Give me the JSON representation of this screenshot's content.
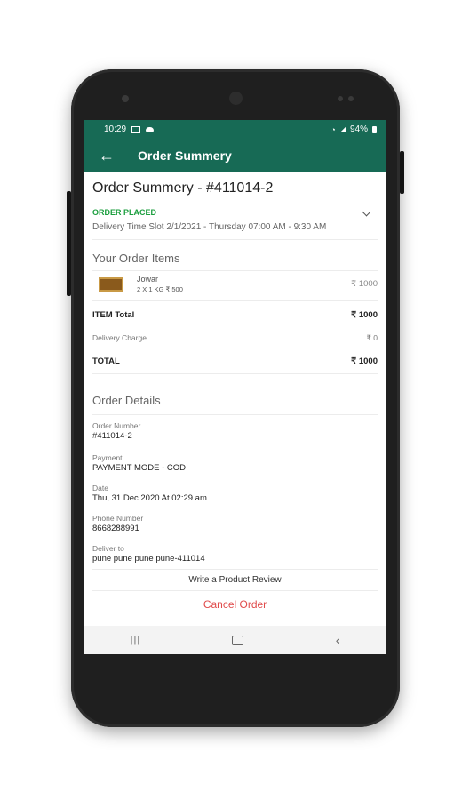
{
  "status_bar": {
    "time": "10:29",
    "battery": "94%"
  },
  "appbar": {
    "title": "Order Summery"
  },
  "order": {
    "heading": "Order Summery - #411014-2",
    "status": "ORDER PLACED",
    "slot": "Delivery Time Slot 2/1/2021 - Thursday 07:00 AM - 9:30 AM"
  },
  "items_section": {
    "title": "Your Order Items",
    "items": [
      {
        "name": "Jowar",
        "qty": "2 X 1 KG ₹ 500",
        "price": "₹ 1000"
      }
    ]
  },
  "totals": {
    "item_total_label": "ITEM Total",
    "item_total_value": "₹ 1000",
    "delivery_label": "Delivery Charge",
    "delivery_value": "₹ 0",
    "total_label": "TOTAL",
    "total_value": "₹ 1000"
  },
  "details": {
    "title": "Order Details",
    "order_number_label": "Order Number",
    "order_number": "#411014-2",
    "payment_label": "Payment",
    "payment": "PAYMENT MODE - COD",
    "date_label": "Date",
    "date": "Thu, 31 Dec 2020 At 02:29 am",
    "phone_label": "Phone Number",
    "phone": "8668288991",
    "deliver_label": "Deliver to",
    "address": "pune pune pune pune-411014"
  },
  "actions": {
    "review": "Write a Product Review",
    "cancel": "Cancel Order"
  },
  "colors": {
    "primary": "#176a55",
    "status_green": "#1b9e3e",
    "cancel_red": "#e04b4b"
  }
}
